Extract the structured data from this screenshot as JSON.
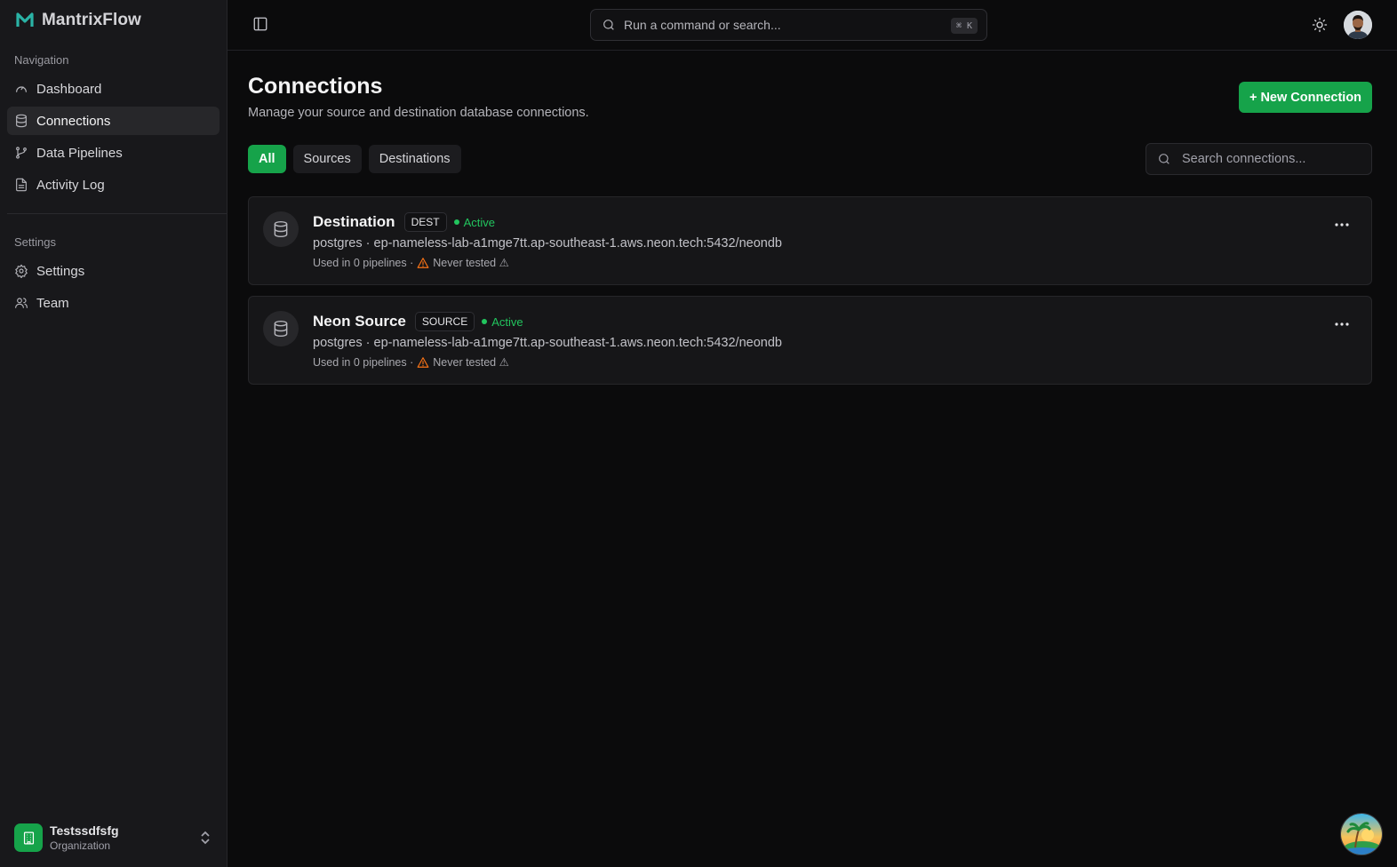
{
  "app": {
    "name": "MantrixFlow"
  },
  "sidebar": {
    "sections": [
      {
        "title": "Navigation"
      },
      {
        "title": "Settings"
      }
    ],
    "nav_items": [
      {
        "label": "Dashboard",
        "icon": "gauge-icon"
      },
      {
        "label": "Connections",
        "icon": "database-icon",
        "active": true
      },
      {
        "label": "Data Pipelines",
        "icon": "git-branch-icon"
      },
      {
        "label": "Activity Log",
        "icon": "file-text-icon"
      }
    ],
    "settings_items": [
      {
        "label": "Settings",
        "icon": "gear-icon"
      },
      {
        "label": "Team",
        "icon": "users-icon"
      }
    ],
    "org": {
      "name": "Testssdfsfg",
      "role": "Organization"
    }
  },
  "topbar": {
    "search_placeholder": "Run a command or search...",
    "shortcut": "⌘ K"
  },
  "page": {
    "title": "Connections",
    "subtitle": "Manage your source and destination database connections.",
    "new_button": "+ New Connection",
    "tabs": [
      {
        "label": "All",
        "active": true
      },
      {
        "label": "Sources"
      },
      {
        "label": "Destinations"
      }
    ],
    "search_placeholder": "Search connections..."
  },
  "connections": [
    {
      "name": "Destination",
      "type": "DEST",
      "status": "Active",
      "connection": "postgres · ep-nameless-lab-a1mge7tt.ap-southeast-1.aws.neon.tech:5432/neondb",
      "usage": "Used in 0 pipelines ·",
      "tested": "Never tested ⚠"
    },
    {
      "name": "Neon Source",
      "type": "SOURCE",
      "status": "Active",
      "connection": "postgres · ep-nameless-lab-a1mge7tt.ap-southeast-1.aws.neon.tech:5432/neondb",
      "usage": "Used in 0 pipelines ·",
      "tested": "Never tested ⚠"
    }
  ],
  "colors": {
    "accent": "#16a34a",
    "status_active": "#22c55e",
    "warning": "#f97316"
  }
}
